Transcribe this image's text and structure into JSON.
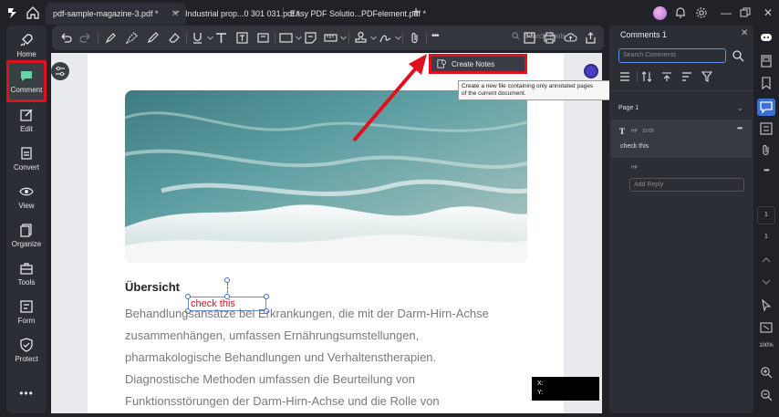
{
  "tabs": [
    {
      "label": "pdf-sample-magazine-3.pdf *",
      "active": true
    },
    {
      "label": "Industrial  prop...0 301 031.pdf *",
      "active": false
    },
    {
      "label": "Easy PDF Solutio...PDFelement.pdf *",
      "active": false
    }
  ],
  "nav": [
    {
      "label": "Home",
      "icon": "rocket-icon"
    },
    {
      "label": "Comment",
      "icon": "comment-icon",
      "active": true
    },
    {
      "label": "Edit",
      "icon": "edit-icon"
    },
    {
      "label": "Convert",
      "icon": "convert-icon"
    },
    {
      "label": "View",
      "icon": "eye-icon"
    },
    {
      "label": "Organize",
      "icon": "organize-icon"
    },
    {
      "label": "Tools",
      "icon": "toolbox-icon"
    },
    {
      "label": "Form",
      "icon": "form-icon"
    },
    {
      "label": "Protect",
      "icon": "shield-icon"
    }
  ],
  "toolbar": {
    "search_placeholder": "Search Tools"
  },
  "document": {
    "heading": "Übersicht",
    "textbox": "check this",
    "paragraph": [
      "Behandlungsansätze bei Erkrankungen, die mit der Darm-Hirn-Achse",
      "zusammenhängen, umfassen Ernährungsumstellungen,",
      "pharmakologische Behandlungen und Verhaltenstherapien.",
      "Diagnostische Methoden umfassen die Beurteilung von",
      "Funktionsstörungen der Darm-Hirn-Achse und die Rolle von"
    ],
    "coords": {
      "x_label": "X:",
      "y_label": "Y:"
    }
  },
  "dropdown": {
    "create_notes": "Create Notes",
    "tooltip_line1": "Create a new file containing only annotated pages",
    "tooltip_line2": "of the current document."
  },
  "comments": {
    "title": "Comments 1",
    "search_placeholder": "Search Comments",
    "page_label": "Page 1",
    "items": [
      {
        "author": "HP",
        "time": "23:05",
        "text": "check this"
      }
    ],
    "reply_author": "HP",
    "reply_placeholder": "Add Reply"
  },
  "rightrail": {
    "page_current": "1",
    "page_total": "1",
    "zoom": "100%"
  },
  "colors": {
    "accent_red": "#e0101e",
    "accent_blue": "#3a6fd8",
    "panel_bg": "#2b2e34"
  }
}
